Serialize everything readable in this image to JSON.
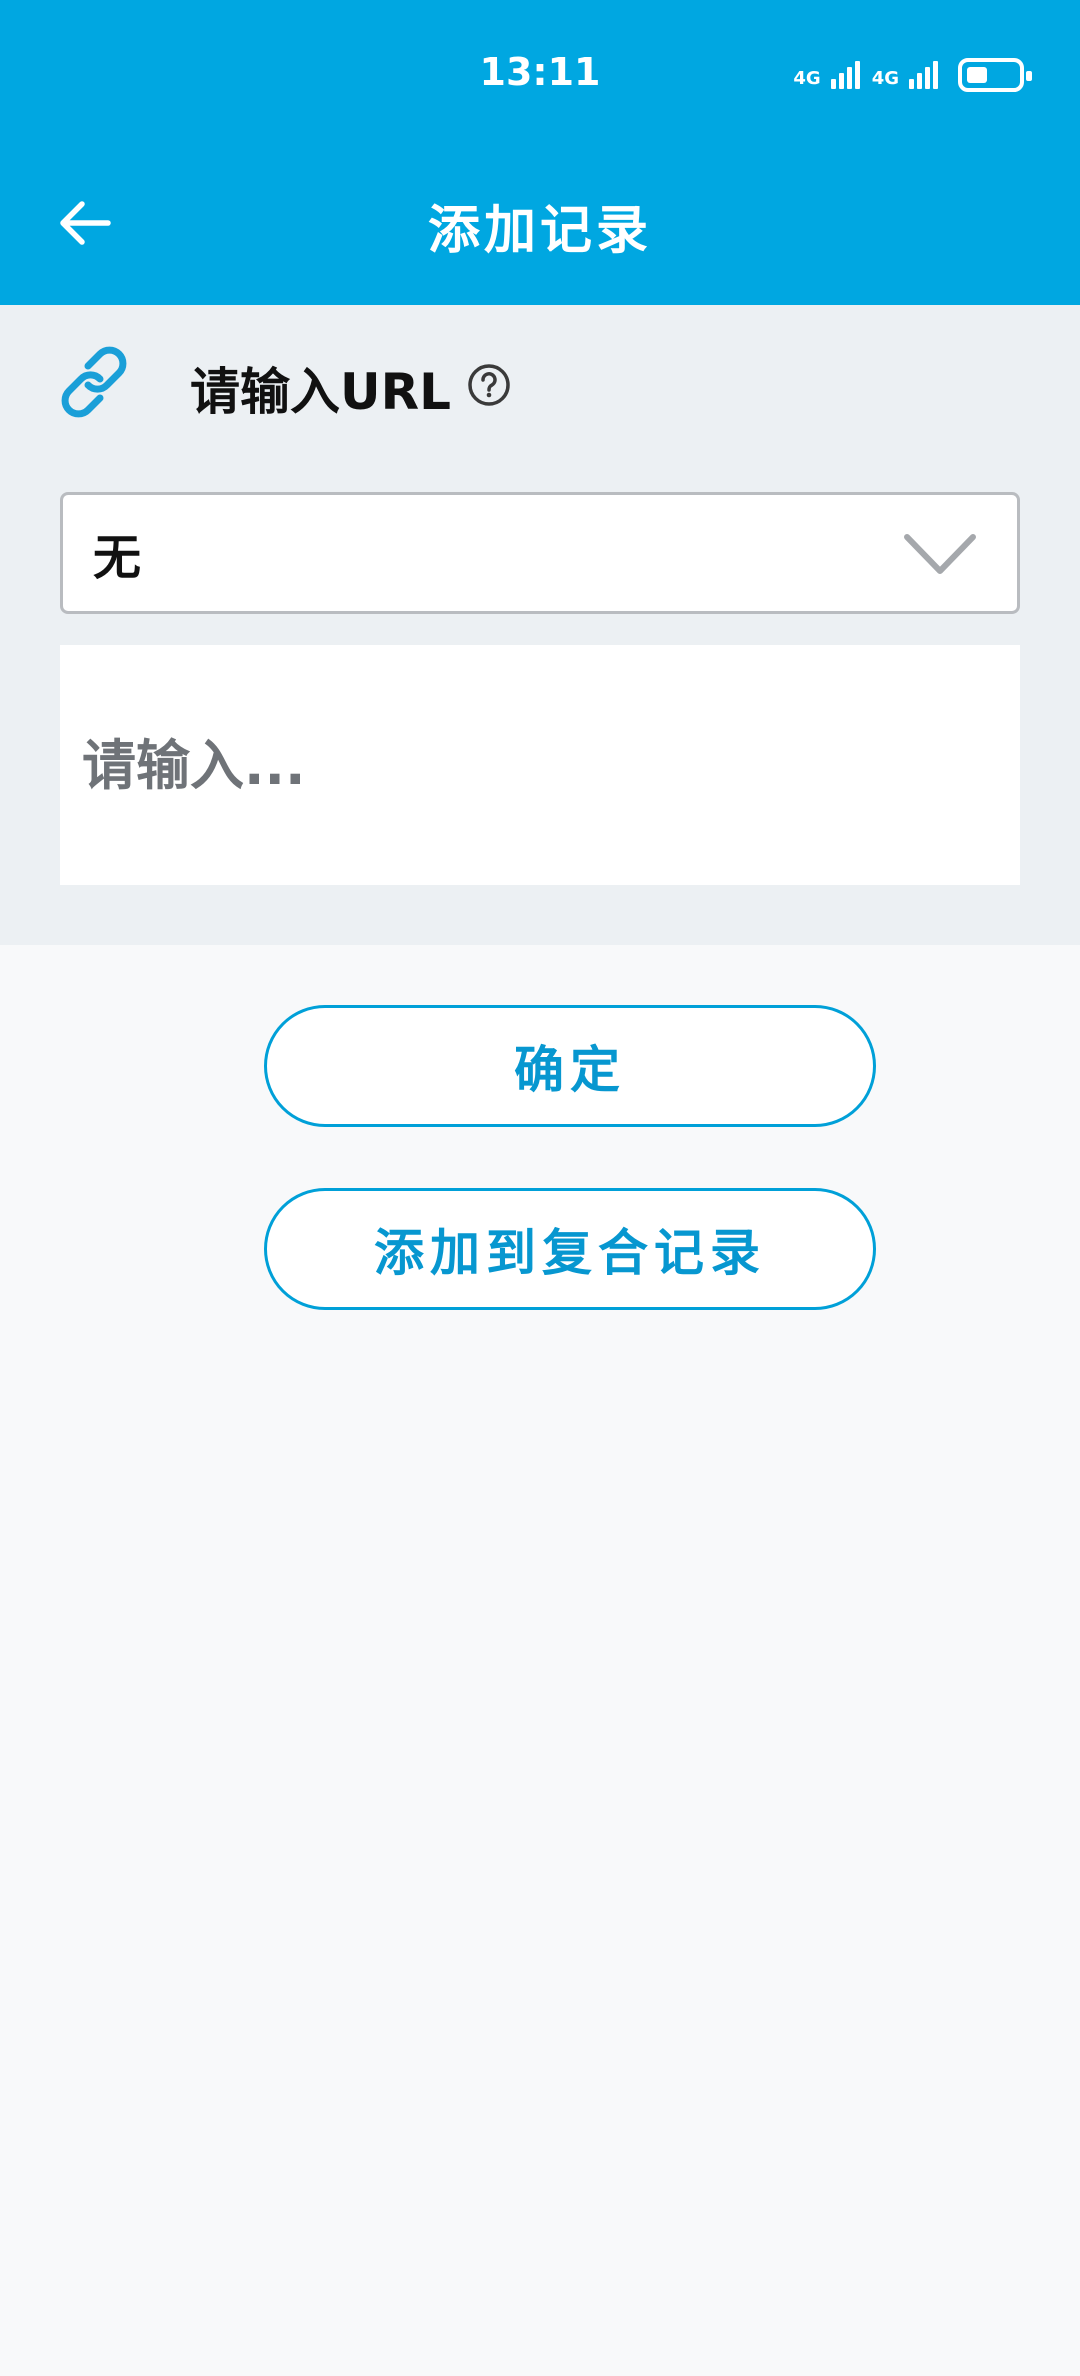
{
  "status_bar": {
    "time": "13:11",
    "signal1_label": "4G",
    "signal2_label": "4G",
    "battery_level": 0.35
  },
  "header": {
    "title": "添加记录",
    "back_icon": "arrow-left-icon"
  },
  "url_section": {
    "icon": "link-icon",
    "label": "请输入URL",
    "help_icon": "question-circle-icon"
  },
  "select": {
    "value": "无",
    "icon": "chevron-down-icon"
  },
  "text_input": {
    "value": "",
    "placeholder": "请输入..."
  },
  "buttons": {
    "confirm": "确定",
    "add_to_composite": "添加到复合记录"
  },
  "colors": {
    "accent": "#00a7e1",
    "panel_bg": "#ecf0f3",
    "page_bg": "#f8f9fa",
    "button_text": "#0797d0"
  }
}
